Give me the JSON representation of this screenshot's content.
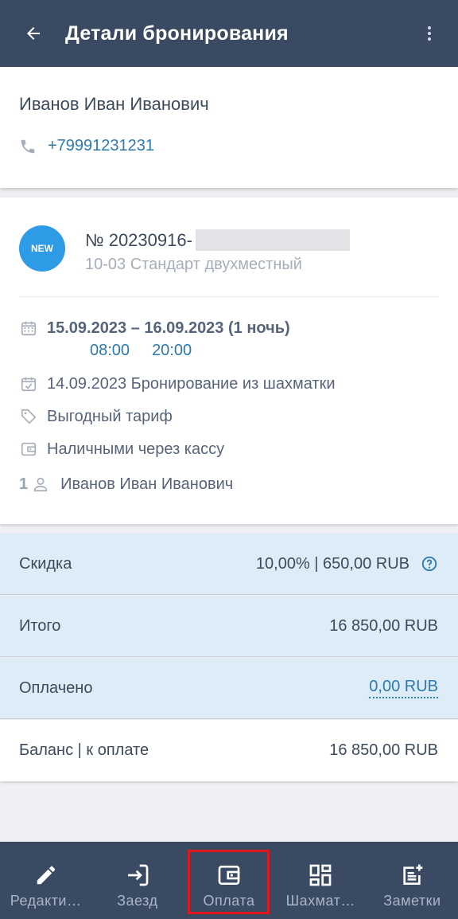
{
  "header": {
    "title": "Детали бронирования",
    "back_icon": "arrow-left-icon",
    "menu_icon": "more-vert-icon"
  },
  "guest": {
    "name": "Иванов Иван Иванович",
    "phone": "+79991231231"
  },
  "booking": {
    "badge": "NEW",
    "number": "№ 20230916-",
    "room": "10-03 Стандарт двухместный",
    "dates": "15.09.2023 – 16.09.2023 (1 ночь)",
    "checkin_time": "08:00",
    "checkout_time": "20:00",
    "created": "14.09.2023 Бронирование из шахматки",
    "tariff": "Выгодный тариф",
    "payment_method": "Наличными через кассу",
    "guest_count": "1",
    "guest_name": "Иванов Иван Иванович"
  },
  "finance": {
    "discount_label": "Скидка",
    "discount_value": "10,00% | 650,00 RUB",
    "total_label": "Итого",
    "total_value": "16 850,00 RUB",
    "paid_label": "Оплачено",
    "paid_value": "0,00 RUB",
    "balance_label": "Баланс | к оплате",
    "balance_value": "16 850,00 RUB"
  },
  "bottom_nav": [
    {
      "label": "Редакти…",
      "icon": "pencil-icon"
    },
    {
      "label": "Заезд",
      "icon": "login-icon"
    },
    {
      "label": "Оплата",
      "icon": "wallet-icon"
    },
    {
      "label": "Шахмат…",
      "icon": "grid-icon"
    },
    {
      "label": "Заметки",
      "icon": "note-add-icon"
    }
  ],
  "colors": {
    "header_bg": "#3a4a63",
    "accent": "#2a7ab0",
    "badge": "#2e9be6",
    "highlight": "#e0181b"
  }
}
